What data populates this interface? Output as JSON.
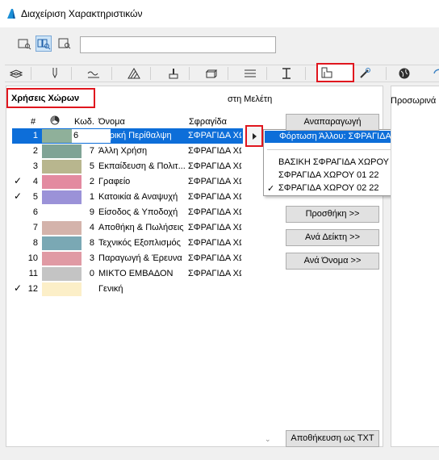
{
  "window": {
    "title": "Διαχείριση Χαρακτηριστικών"
  },
  "toolbar": {
    "search_value": ""
  },
  "tabs": [
    "layers",
    "pens",
    "line-types",
    "fill-types",
    "surfaces",
    "building-materials",
    "composites",
    "profiles",
    "zone-categories",
    "renovation-filters",
    "mep"
  ],
  "section": {
    "title": "Χρήσεις Χώρων",
    "study_label": "στη Μελέτη"
  },
  "list": {
    "headers": {
      "num": "#",
      "color": "color-icon",
      "code": "Κωδ.",
      "name": "Όνομα",
      "stamp": "Σφραγίδα"
    },
    "rows": [
      {
        "checked": false,
        "num": "1",
        "color": "#8fb09a",
        "code": "6",
        "name": "Ιατρική Περίθαλψη",
        "stamp": "ΣΦΡΑΓΙΔΑ ΧΩ"
      },
      {
        "checked": false,
        "num": "2",
        "color": "#7fa395",
        "code": "7",
        "name": "Άλλη Χρήση",
        "stamp": "ΣΦΡΑΓΙΔΑ ΧΩ"
      },
      {
        "checked": false,
        "num": "3",
        "color": "#b8b68e",
        "code": "5",
        "name": "Εκπαίδευση & Πολιτ...",
        "stamp": "ΣΦΡΑΓΙΔΑ ΧΩ"
      },
      {
        "checked": true,
        "num": "4",
        "color": "#e38aa0",
        "code": "2",
        "name": "Γραφείο",
        "stamp": "ΣΦΡΑΓΙΔΑ ΧΩ"
      },
      {
        "checked": true,
        "num": "5",
        "color": "#9b92d8",
        "code": "1",
        "name": "Κατοικία & Αναψυχή",
        "stamp": "ΣΦΡΑΓΙΔΑ ΧΩ"
      },
      {
        "checked": false,
        "num": "6",
        "color": "",
        "code": "9",
        "name": "Είσοδος & Υποδοχή",
        "stamp": "ΣΦΡΑΓΙΔΑ ΧΩ"
      },
      {
        "checked": false,
        "num": "7",
        "color": "#d4b3ab",
        "code": "4",
        "name": "Αποθήκη & Πωλήσεις",
        "stamp": "ΣΦΡΑΓΙΔΑ ΧΩ"
      },
      {
        "checked": false,
        "num": "8",
        "color": "#7aa8b4",
        "code": "8",
        "name": "Τεχνικός Εξοπλισμός",
        "stamp": "ΣΦΡΑΓΙΔΑ ΧΩ"
      },
      {
        "checked": false,
        "num": "10",
        "color": "#e09aa4",
        "code": "3",
        "name": "Παραγωγή & Έρευνα",
        "stamp": "ΣΦΡΑΓΙΔΑ ΧΩ"
      },
      {
        "checked": false,
        "num": "11",
        "color": "#c4c4c4",
        "code": "0",
        "name": "ΜΙΚΤΟ ΕΜΒΑΔΟΝ",
        "stamp": "ΣΦΡΑΓΙΔΑ ΧΩ"
      },
      {
        "checked": true,
        "num": "12",
        "color": "#fcefc8",
        "code": "",
        "name": "Γενική",
        "stamp": ""
      }
    ]
  },
  "popup": {
    "load_label": "Φόρτωση Άλλου: ΣΦΡΑΓΙΔΑ ΧΩΡΟΥ...",
    "items": [
      {
        "label": "ΒΑΣΙΚΗ ΣΦΡΑΓΙΔΑ ΧΩΡΟΥ",
        "checked": false
      },
      {
        "label": "ΣΦΡΑΓΙΔΑ ΧΩΡΟΥ 01 22",
        "checked": false
      },
      {
        "label": "ΣΦΡΑΓΙΔΑ ΧΩΡΟΥ 02 22",
        "checked": true
      }
    ]
  },
  "buttons": {
    "reproduce": "Αναπαραγωγή",
    "add": "Προσθήκη >>",
    "by_index": "Ανά Δείκτη >>",
    "by_name": "Ανά Όνομα >>",
    "save_txt": "Αποθήκευση ως TXT"
  },
  "right_panel": {
    "label": "Προσωρινά"
  },
  "colors": {
    "accent": "#0d6ed9",
    "highlight": "#e0161e"
  }
}
